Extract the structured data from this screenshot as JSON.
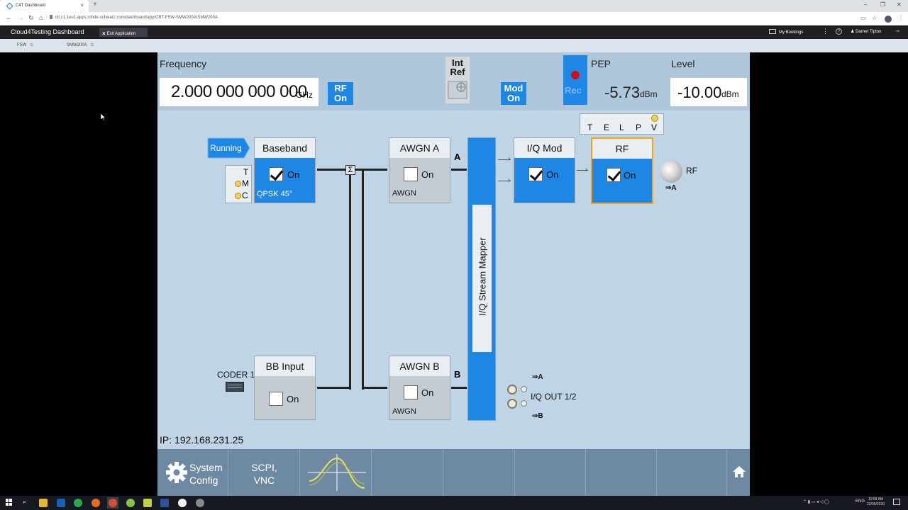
{
  "browser": {
    "tab_title": "C4T Dashboard",
    "tab_close": "×",
    "new_tab": "+",
    "url": "clt.c1.1eu1.apps.rohde-schwarz.com/dashboard/app/CBT-FSW-SMW200A/SMW200A",
    "win_min": "–",
    "win_max": "❐",
    "win_close": "✕"
  },
  "app_header": {
    "brand": "Cloud4Testing Dashboard",
    "exit_label": "Exit Application",
    "exit_icon": "×",
    "bookings_label": "My Bookings",
    "menu_dots": "⋮",
    "help": "?",
    "user_name": "Darren Tipton",
    "logout": "⇥"
  },
  "instrument_tabs": [
    {
      "label": "FSW",
      "ext": "⧉"
    },
    {
      "label": "SMW200A",
      "ext": "⧉"
    }
  ],
  "instrument": {
    "frequency_label": "Frequency",
    "frequency_value": "2.000 000 000 000",
    "frequency_unit": "GHz",
    "rf_on": [
      "RF",
      "On"
    ],
    "int_ref": [
      "Int",
      "Ref"
    ],
    "mod_on": [
      "Mod",
      "On"
    ],
    "rec_label": "Rec",
    "pep_label": "PEP",
    "pep_value": "-5.73",
    "pep_unit": "dBm",
    "level_label": "Level",
    "level_value": "-10.00",
    "level_unit": "dBm",
    "telpv": [
      "T",
      "E",
      "L",
      "P",
      "V"
    ],
    "running": "Running",
    "tmc": [
      "T",
      "M",
      "C"
    ],
    "baseband": {
      "title": "Baseband",
      "on": "On",
      "sub": "QPSK 45°",
      "checked": true
    },
    "awgn_a": {
      "title": "AWGN A",
      "on": "On",
      "sub": "AWGN",
      "checked": false
    },
    "path_a": "A",
    "iq_mod": {
      "title": "I/Q Mod",
      "on": "On",
      "checked": true
    },
    "rf": {
      "title": "RF",
      "on": "On",
      "checked": true
    },
    "rf_out_label": "RF",
    "rf_out_a": "⇒A",
    "sum_symbol": "Σ",
    "stream_mapper": "I/Q Stream Mapper",
    "coder": "CODER 1",
    "bb_input": {
      "title": "BB Input",
      "on": "On",
      "checked": false
    },
    "awgn_b": {
      "title": "AWGN B",
      "on": "On",
      "sub": "AWGN",
      "checked": false
    },
    "path_b": "B",
    "iq_out_label": "I/Q OUT 1/2",
    "iq_out_a": "⇒A",
    "iq_out_b": "⇒B",
    "ip": "IP: 192.168.231.25",
    "softkeys": {
      "system_config": [
        "System",
        "Config"
      ],
      "scpi_vnc": [
        "SCPI,",
        "VNC"
      ]
    }
  },
  "taskbar": {
    "lang": "ENG",
    "time": "10:58 AM",
    "date": "22/05/2020"
  }
}
